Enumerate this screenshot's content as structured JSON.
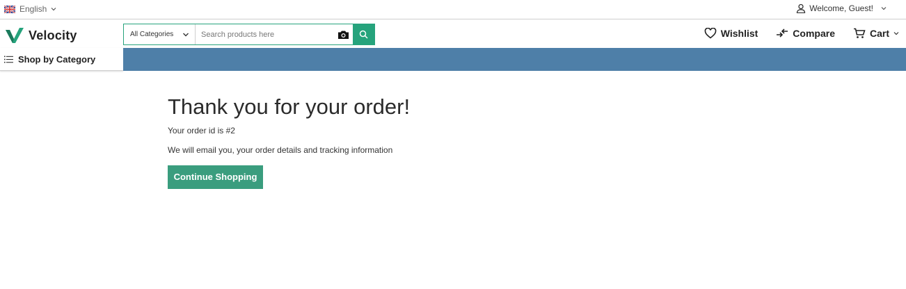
{
  "topbar": {
    "language": "English",
    "welcome": "Welcome, Guest!"
  },
  "header": {
    "logo_text": "Velocity",
    "search": {
      "category": "All Categories",
      "placeholder": "Search products here"
    },
    "links": {
      "wishlist": "Wishlist",
      "compare": "Compare",
      "cart": "Cart"
    }
  },
  "category_bar": {
    "label": "Shop by Category"
  },
  "main": {
    "title": "Thank you for your order!",
    "order_line": "Your order id is #2",
    "email_line": "We will email you, your order details and tracking information",
    "continue_label": "Continue Shopping"
  },
  "colors": {
    "accent": "#26a37c",
    "banner": "#4e7fa8",
    "button": "#3a9d7e"
  }
}
